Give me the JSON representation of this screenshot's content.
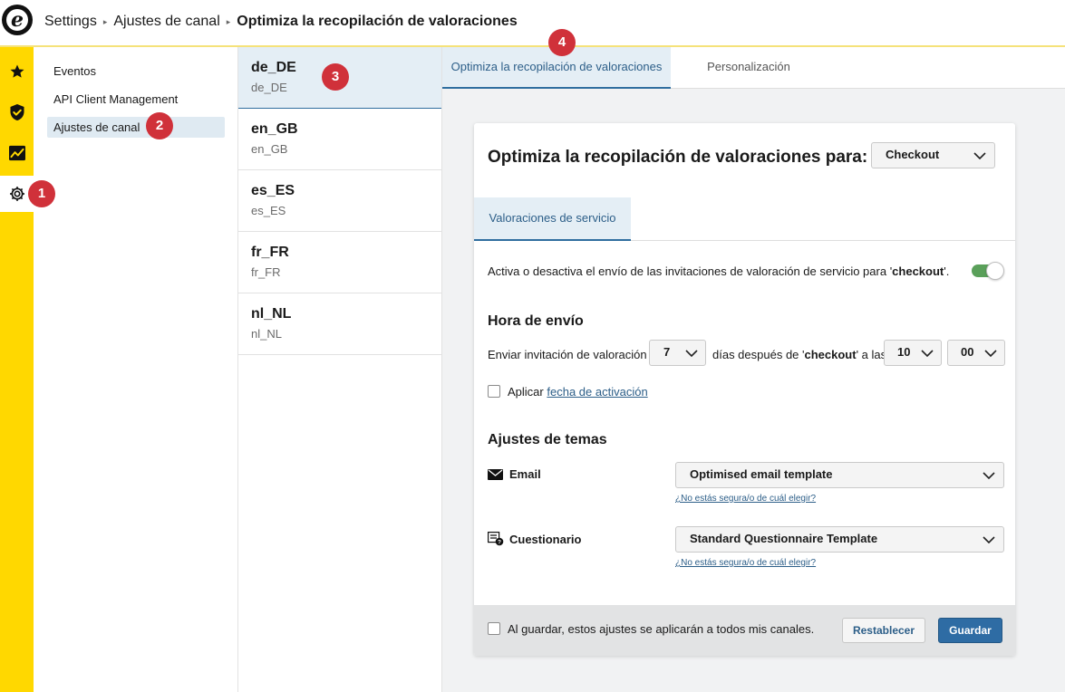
{
  "header": {
    "logo_letter": "e",
    "breadcrumb": [
      "Settings",
      "Ajustes de canal",
      "Optimiza la recopilación de valoraciones"
    ],
    "separator": "▸"
  },
  "rail": {
    "items": [
      {
        "icon": "star-icon"
      },
      {
        "icon": "shield-check-icon"
      },
      {
        "icon": "chart-trend-icon"
      },
      {
        "icon": "gear-icon",
        "active": true
      }
    ]
  },
  "nav": {
    "items": [
      {
        "label": "Eventos"
      },
      {
        "label": "API Client Management"
      },
      {
        "label": "Ajustes de canal",
        "active": true
      }
    ]
  },
  "locales": {
    "items": [
      {
        "name": "de_DE",
        "sub": "de_DE",
        "active": true
      },
      {
        "name": "en_GB",
        "sub": "en_GB"
      },
      {
        "name": "es_ES",
        "sub": "es_ES"
      },
      {
        "name": "fr_FR",
        "sub": "fr_FR"
      },
      {
        "name": "nl_NL",
        "sub": "nl_NL"
      }
    ]
  },
  "tabs": {
    "items": [
      {
        "label": "Optimiza la recopilación de valoraciones",
        "active": true
      },
      {
        "label": "Personalización"
      }
    ]
  },
  "card": {
    "title": "Optimiza la recopilación de valoraciones para:",
    "trigger_select": "Checkout",
    "subtab": "Valoraciones de servicio",
    "toggle_text_prefix": "Activa o desactiva el envío de las invitaciones de valoración de servicio para '",
    "toggle_text_bold": "checkout",
    "toggle_text_suffix": "'.",
    "toggle_on": true,
    "send_time_heading": "Hora de envío",
    "send_prefix": "Enviar invitación de valoración",
    "days_value": "7",
    "days_text_prefix": "días después de '",
    "days_text_bold": "checkout",
    "days_text_suffix": "' a las",
    "hour_value": "10",
    "minute_value": "00",
    "apply_label": "Aplicar",
    "apply_link": "fecha de activación",
    "themes_heading": "Ajustes de temas",
    "email_label": "Email",
    "email_select": "Optimised email template",
    "help_link": "¿No estás segura/o de cuál elegir?",
    "questionnaire_label": "Cuestionario",
    "questionnaire_select": "Standard Questionnaire Template",
    "footer_checkbox": "Al guardar, estos ajustes se aplicarán a todos mis canales.",
    "reset_button": "Restablecer",
    "save_button": "Guardar"
  },
  "markers": [
    "1",
    "2",
    "3",
    "4"
  ],
  "colors": {
    "rail": "#ffd800",
    "accent": "#2f6e9f",
    "primary_button": "#2e6ca4",
    "toggle_on": "#5aa05a",
    "marker": "#d0313a"
  }
}
